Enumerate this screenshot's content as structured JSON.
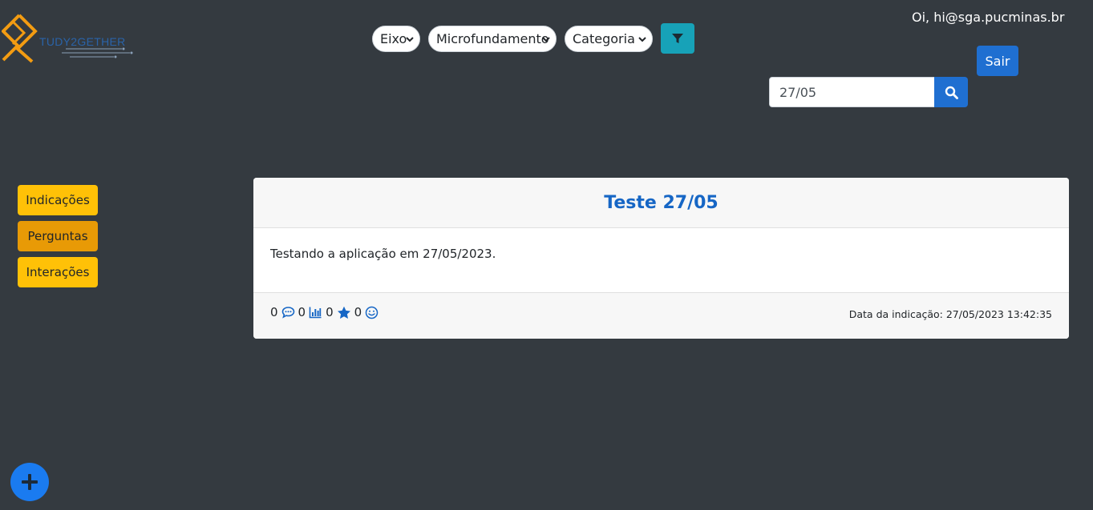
{
  "brand": {
    "logo_text": "TUDY2GETHER",
    "primary_color": "#ffc107",
    "accent_color": "#1f6fd1"
  },
  "filters": {
    "eixo": "Eixo",
    "microfundamento": "Microfundamento",
    "categoria": "Categoria",
    "filter_icon": "filter-icon"
  },
  "user": {
    "greeting": "Oi, hi@sga.pucminas.br",
    "logout_label": "Sair"
  },
  "search": {
    "value": "27/05",
    "icon": "search-icon"
  },
  "sidebar": {
    "items": [
      {
        "label": "Indicações",
        "active": false
      },
      {
        "label": "Perguntas",
        "active": true
      },
      {
        "label": "Interações",
        "active": false
      }
    ]
  },
  "post": {
    "title": "Teste 27/05",
    "body": "Testando a aplicação em 27/05/2023.",
    "stats": [
      {
        "count": "0",
        "icon": "comment-icon"
      },
      {
        "count": "0",
        "icon": "chart-icon"
      },
      {
        "count": "0",
        "icon": "star-icon"
      },
      {
        "count": "0",
        "icon": "smile-icon"
      }
    ],
    "date_label": "Data da indicação: 27/05/2023 13:42:35"
  },
  "fab": {
    "icon": "plus-icon"
  }
}
